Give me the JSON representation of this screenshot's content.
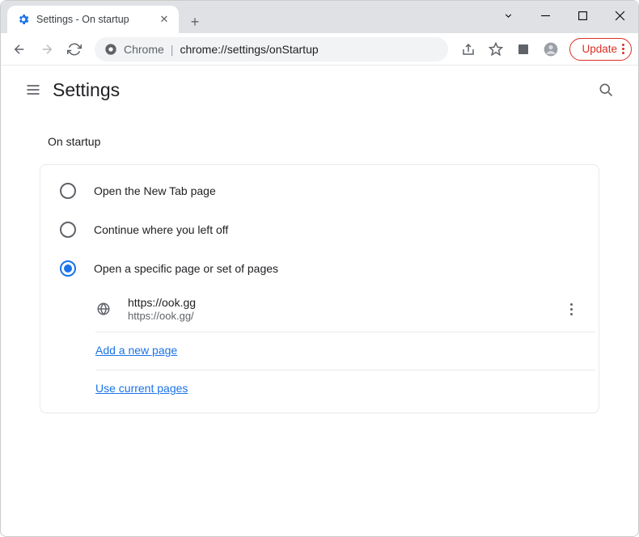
{
  "tab": {
    "title": "Settings - On startup"
  },
  "omnibox": {
    "prefix": "Chrome",
    "path": "chrome://settings/onStartup"
  },
  "update": {
    "label": "Update"
  },
  "header": {
    "title": "Settings"
  },
  "section": {
    "title": "On startup"
  },
  "radios": {
    "new_tab": "Open the New Tab page",
    "continue": "Continue where you left off",
    "specific": "Open a specific page or set of pages"
  },
  "page_entry": {
    "title": "https://ook.gg",
    "url": "https://ook.gg/"
  },
  "links": {
    "add": "Add a new page",
    "use_current": "Use current pages"
  }
}
